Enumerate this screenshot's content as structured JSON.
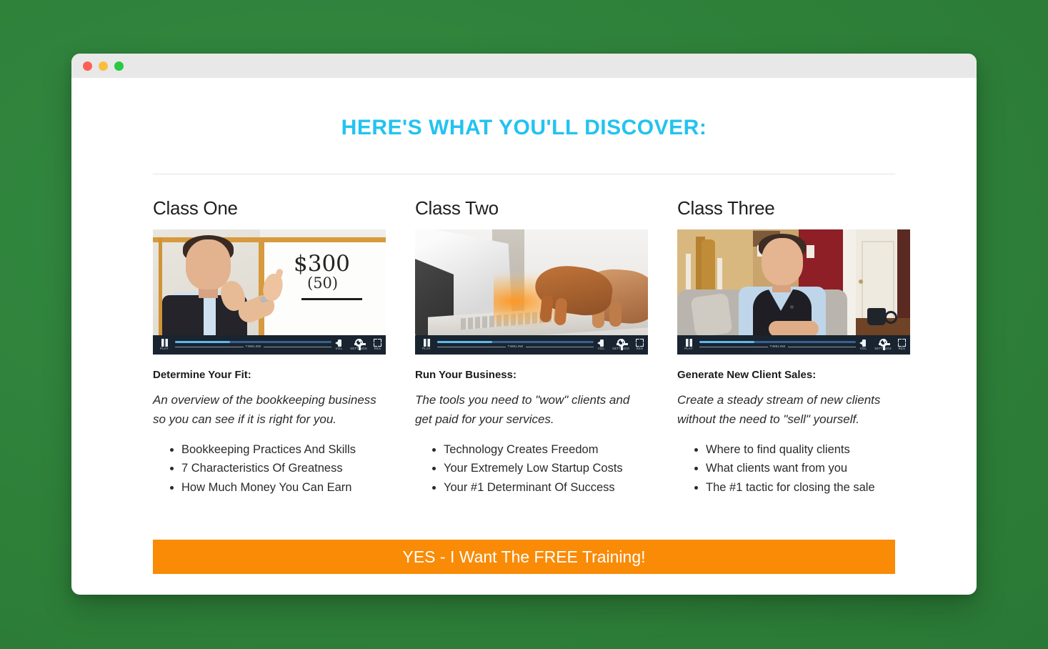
{
  "window": {
    "traffic_lights": [
      {
        "name": "close",
        "color": "#fb5f56"
      },
      {
        "name": "minimize",
        "color": "#fbbd3e"
      },
      {
        "name": "maximize",
        "color": "#27ca40"
      }
    ]
  },
  "page": {
    "headline": "HERE'S WHAT YOU'LL DISCOVER:",
    "headline_color": "#22c3f0",
    "background_color": "#2e8039"
  },
  "player": {
    "play_label": "PLAY",
    "timeline_label": "TIMELINE",
    "volume_label": "VOL.",
    "settings_label": "SETTINGS",
    "resolution_label": "RES",
    "progress_percent": 35
  },
  "columns": [
    {
      "title": "Class One",
      "thumbnail_alt": "Man in black vest at a whiteboard showing $300 (50)",
      "lede": "Determine Your Fit:",
      "description": "An overview of the bookkeeping business so you can see if it is right for you.",
      "bullets": [
        "Bookkeeping Practices And Skills",
        "7 Characteristics Of Greatness",
        "How Much Money You Can Earn"
      ]
    },
    {
      "title": "Class Two",
      "thumbnail_alt": "Hands typing on a laptop with warm sunlight",
      "lede": "Run Your Business:",
      "description": "The tools you need to \"wow\" clients and get paid for your services.",
      "bullets": [
        "Technology Creates Freedom",
        "Your Extremely Low Startup Costs",
        "Your #1 Determinant Of Success"
      ]
    },
    {
      "title": "Class Three",
      "thumbnail_alt": "Man in black vest seated on a sofa in a home interior",
      "lede": "Generate New Client Sales:",
      "description": "Create a steady stream of new clients without the need to \"sell\" yourself.",
      "bullets": [
        "Where to find quality clients",
        "What clients want from you",
        "The #1 tactic for closing the sale"
      ]
    }
  ],
  "cta": {
    "label": "YES - I Want The FREE Training!",
    "color": "#f98b07"
  }
}
